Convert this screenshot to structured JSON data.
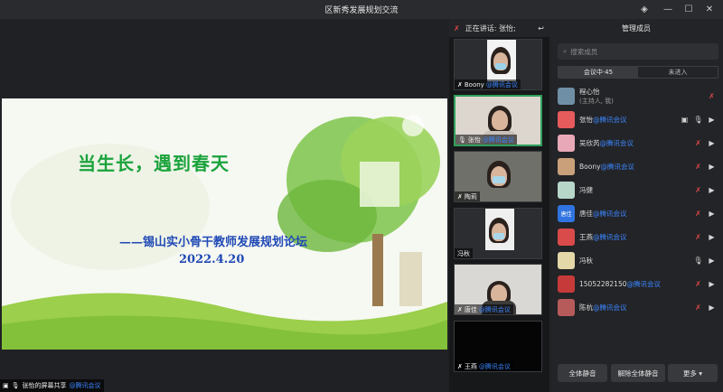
{
  "window": {
    "title": "区新秀发展规划交流"
  },
  "slide": {
    "title": "当生长，遇到春天",
    "subtitle": "——锡山实小骨干教师发展规划论坛",
    "date": "2022.4.20"
  },
  "share_bar": {
    "sharer": "张怡的屏幕共享",
    "suffix": "@腾讯会议"
  },
  "speaking": {
    "label": "正在讲话: 张怡;"
  },
  "video_tiles": [
    {
      "name": "Boony",
      "suffix": "@腾讯会议"
    },
    {
      "name": "张怡",
      "suffix": "@腾讯会议"
    },
    {
      "name": "陶莉",
      "suffix": ""
    },
    {
      "name": "冯秋",
      "suffix": ""
    },
    {
      "name": "唐佳",
      "suffix": "@腾讯会议"
    },
    {
      "name": "王燕",
      "suffix": "@腾讯会议"
    }
  ],
  "panel": {
    "title": "管理成员",
    "search_placeholder": "搜索成员",
    "tabs": [
      "会议中·45",
      "未进入"
    ],
    "members": [
      {
        "name": "程心怡",
        "suffix": "",
        "sub": "(主持人, 我)",
        "avatar_color": "#6f8fa6",
        "avatar_text": ""
      },
      {
        "name": "张怡",
        "suffix": "@腾讯会议",
        "sub": "",
        "avatar_color": "#e65b5b",
        "avatar_text": ""
      },
      {
        "name": "吴欣芮",
        "suffix": "@腾讯会议",
        "sub": "",
        "avatar_color": "#e9a8b8",
        "avatar_text": ""
      },
      {
        "name": "Boony",
        "suffix": "@腾讯会议",
        "sub": "",
        "avatar_color": "#c9a07a",
        "avatar_text": ""
      },
      {
        "name": "冯健",
        "suffix": "",
        "sub": "",
        "avatar_color": "#b7d7c9",
        "avatar_text": ""
      },
      {
        "name": "唐佳",
        "suffix": "@腾讯会议",
        "sub": "",
        "avatar_color": "#2f74e0",
        "avatar_text": "唐佳"
      },
      {
        "name": "王燕",
        "suffix": "@腾讯会议",
        "sub": "",
        "avatar_color": "#d94a4a",
        "avatar_text": ""
      },
      {
        "name": "冯秋",
        "suffix": "",
        "sub": "",
        "avatar_color": "#e4d7a8",
        "avatar_text": ""
      },
      {
        "name": "15052282150",
        "suffix": "@腾讯会议",
        "sub": "",
        "avatar_color": "#c73a3a",
        "avatar_text": ""
      },
      {
        "name": "陈杭",
        "suffix": "@腾讯会议",
        "sub": "",
        "avatar_color": "#b65a5a",
        "avatar_text": ""
      }
    ],
    "buttons": {
      "mute_all": "全体静音",
      "unmute_all": "解除全体静音",
      "more": "更多 ▾"
    }
  },
  "colors": {
    "accent_blue": "#3b86ff",
    "active_green": "#2ea05a",
    "muted_red": "#e0494a"
  }
}
